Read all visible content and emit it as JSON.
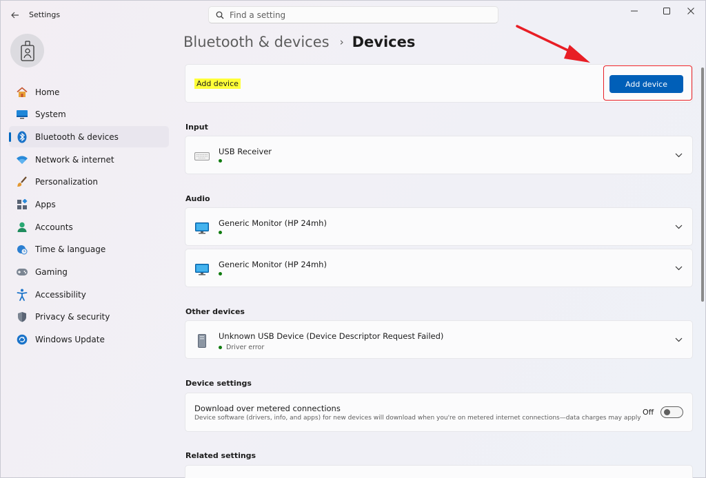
{
  "app": {
    "title": "Settings"
  },
  "search": {
    "placeholder": "Find a setting"
  },
  "sidebar": {
    "items": [
      {
        "label": "Home",
        "icon": "home-icon"
      },
      {
        "label": "System",
        "icon": "system-icon"
      },
      {
        "label": "Bluetooth & devices",
        "icon": "bluetooth-icon",
        "active": true
      },
      {
        "label": "Network & internet",
        "icon": "wifi-icon"
      },
      {
        "label": "Personalization",
        "icon": "brush-icon"
      },
      {
        "label": "Apps",
        "icon": "apps-icon"
      },
      {
        "label": "Accounts",
        "icon": "accounts-icon"
      },
      {
        "label": "Time & language",
        "icon": "globe-clock-icon"
      },
      {
        "label": "Gaming",
        "icon": "gamepad-icon"
      },
      {
        "label": "Accessibility",
        "icon": "accessibility-icon"
      },
      {
        "label": "Privacy & security",
        "icon": "shield-icon"
      },
      {
        "label": "Windows Update",
        "icon": "windows-update-icon"
      }
    ]
  },
  "breadcrumb": {
    "parent": "Bluetooth & devices",
    "separator": "›",
    "current": "Devices"
  },
  "add_device": {
    "label": "Add device",
    "button_label": "Add device"
  },
  "sections": {
    "input": "Input",
    "audio": "Audio",
    "other": "Other devices",
    "device_settings": "Device settings",
    "related": "Related settings"
  },
  "devices": {
    "input": [
      {
        "name": "USB Receiver",
        "status": "",
        "icon": "keyboard-icon"
      }
    ],
    "audio": [
      {
        "name": "Generic Monitor (HP 24mh)",
        "status": "",
        "icon": "monitor-icon"
      },
      {
        "name": "Generic Monitor (HP 24mh)",
        "status": "",
        "icon": "monitor-icon"
      }
    ],
    "other": [
      {
        "name": "Unknown USB Device (Device Descriptor Request Failed)",
        "status": "Driver error",
        "icon": "usb-device-icon"
      }
    ]
  },
  "device_settings": {
    "title": "Download over metered connections",
    "description": "Device software (drivers, info, and apps) for new devices will download when you're on metered internet connections—data charges may apply",
    "toggle_label": "Off",
    "toggle_on": false
  },
  "colors": {
    "accent": "#005fb8",
    "highlight": "#ffff38",
    "callout": "#e81e25",
    "status_ok": "#0f7b0f"
  }
}
